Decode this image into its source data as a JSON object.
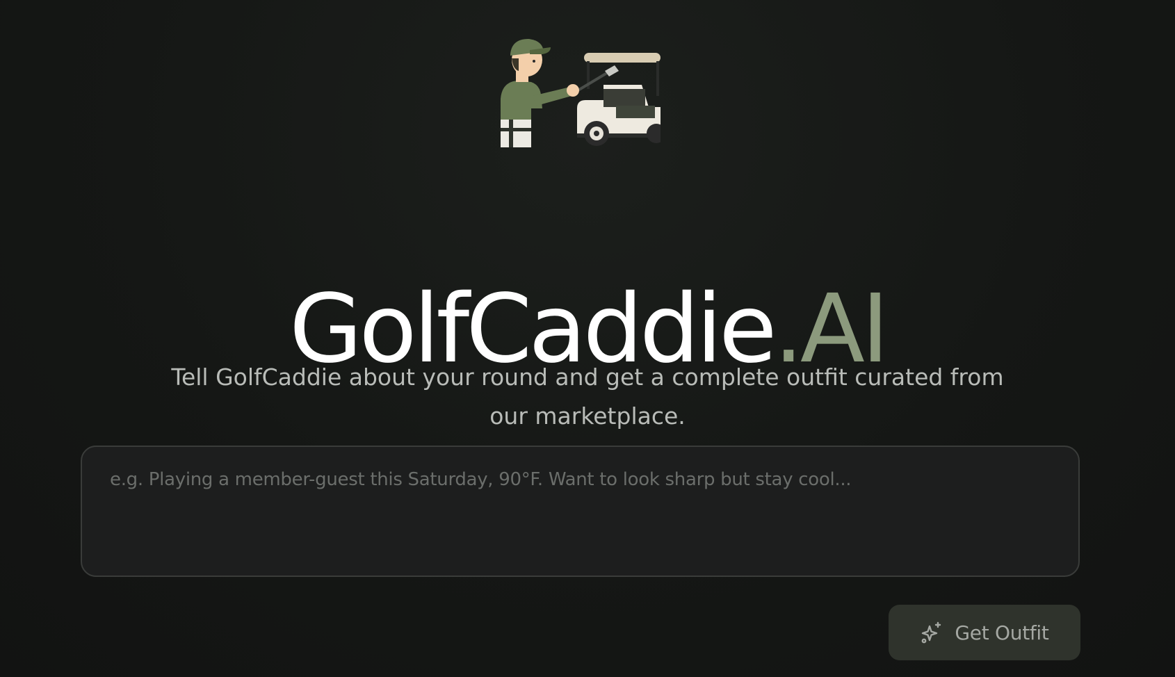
{
  "brand": {
    "name_main": "GolfCaddie",
    "name_accent": ".AI",
    "accent_color": "#8c9a7d"
  },
  "hero": {
    "mascot_icon": "golfer-with-cart-icon",
    "subtitle": "Tell GolfCaddie about your round and get a complete outfit curated from our marketplace."
  },
  "prompt": {
    "value": "",
    "placeholder": "e.g. Playing a member-guest this Saturday, 90°F. Want to look sharp but stay cool..."
  },
  "actions": {
    "submit_label": "Get Outfit",
    "submit_icon": "sparkles-icon"
  }
}
